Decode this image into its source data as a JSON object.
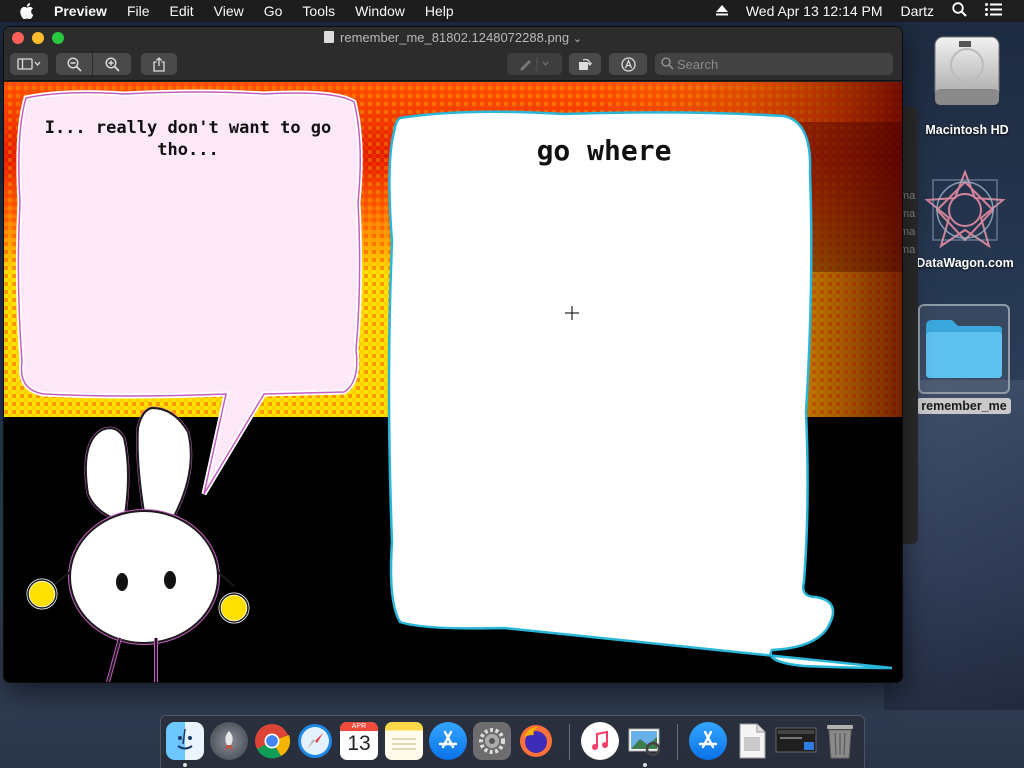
{
  "menubar": {
    "app_name": "Preview",
    "items": [
      "File",
      "Edit",
      "View",
      "Go",
      "Tools",
      "Window",
      "Help"
    ],
    "datetime": "Wed Apr 13  12:14 PM",
    "user": "Dartz"
  },
  "desktop": {
    "icons": [
      {
        "label": "Macintosh HD"
      },
      {
        "label": "DataWagon.com"
      },
      {
        "label": "remember_me"
      }
    ],
    "back_window_rows": [
      "ma",
      "ma",
      "ma",
      "ma"
    ]
  },
  "window": {
    "title": "remember_me_81802.1248072288.png",
    "title_suffix": "⌄",
    "search_placeholder": "Search"
  },
  "comic": {
    "bubble_left_text": "I... really don't want to go tho...",
    "bubble_right_text": "go where"
  },
  "dock": {
    "apps": [
      "finder-icon",
      "launchpad-icon",
      "chrome-icon",
      "safari-icon",
      "calendar-icon",
      "notes-icon",
      "app-store-icon",
      "system-preferences-icon",
      "firefox-icon",
      "itunes-icon",
      "preview-icon",
      "app-store-download-icon",
      "file-icon",
      "screenshot-icon",
      "trash-icon"
    ],
    "calendar_month": "APR",
    "calendar_day": "13"
  },
  "colors": {
    "menubar_bg": "#1e1e1e",
    "window_bg": "#262626",
    "bubble_left_fill": "#fde8f8",
    "bubble_right_outline": "#29b6d8"
  }
}
